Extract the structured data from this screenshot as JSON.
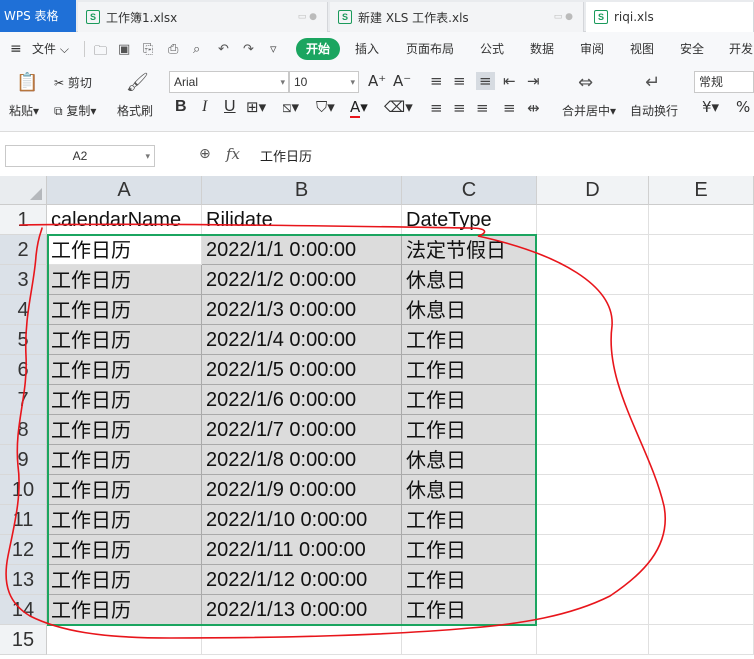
{
  "app": {
    "name": "WPS 表格"
  },
  "tabs": [
    {
      "label": "工作簿1.xlsx"
    },
    {
      "label": "新建 XLS 工作表.xls"
    },
    {
      "label": "riqi.xls"
    }
  ],
  "menu": {
    "file": "文件",
    "start": "开始",
    "insert": "插入",
    "page_layout": "页面布局",
    "formula": "公式",
    "data": "数据",
    "review": "审阅",
    "view": "视图",
    "security": "安全",
    "dev": "开发"
  },
  "ribbon": {
    "paste": "粘贴",
    "cut": "剪切",
    "copy": "复制",
    "format_painter": "格式刷",
    "font_name": "Arial",
    "font_size": "10",
    "bold": "B",
    "italic": "I",
    "underline": "U",
    "merge_center": "合并居中",
    "wrap_text": "自动换行",
    "number_format": "常规",
    "currency": "¥",
    "percent": "%"
  },
  "formula_bar": {
    "cell_ref": "A2",
    "fx": "fx",
    "value": "工作日历"
  },
  "columns": [
    "A",
    "B",
    "C",
    "D",
    "E"
  ],
  "rows": [
    {
      "num": "1",
      "a": "calendarName",
      "b": "Rilidate",
      "c": "DateType"
    },
    {
      "num": "2",
      "a": "工作日历",
      "b": "2022/1/1 0:00:00",
      "c": "法定节假日"
    },
    {
      "num": "3",
      "a": "工作日历",
      "b": "2022/1/2 0:00:00",
      "c": "休息日"
    },
    {
      "num": "4",
      "a": "工作日历",
      "b": "2022/1/3 0:00:00",
      "c": "休息日"
    },
    {
      "num": "5",
      "a": "工作日历",
      "b": "2022/1/4 0:00:00",
      "c": "工作日"
    },
    {
      "num": "6",
      "a": "工作日历",
      "b": "2022/1/5 0:00:00",
      "c": "工作日"
    },
    {
      "num": "7",
      "a": "工作日历",
      "b": "2022/1/6 0:00:00",
      "c": "工作日"
    },
    {
      "num": "8",
      "a": "工作日历",
      "b": "2022/1/7 0:00:00",
      "c": "工作日"
    },
    {
      "num": "9",
      "a": "工作日历",
      "b": "2022/1/8 0:00:00",
      "c": "休息日"
    },
    {
      "num": "10",
      "a": "工作日历",
      "b": "2022/1/9 0:00:00",
      "c": "休息日"
    },
    {
      "num": "11",
      "a": "工作日历",
      "b": "2022/1/10 0:00:00",
      "c": "工作日"
    },
    {
      "num": "12",
      "a": "工作日历",
      "b": "2022/1/11 0:00:00",
      "c": "工作日"
    },
    {
      "num": "13",
      "a": "工作日历",
      "b": "2022/1/12 0:00:00",
      "c": "工作日"
    },
    {
      "num": "14",
      "a": "工作日历",
      "b": "2022/1/13 0:00:00",
      "c": "工作日"
    },
    {
      "num": "15",
      "a": "",
      "b": "",
      "c": ""
    }
  ],
  "colors": {
    "accent_green": "#1ba560",
    "wps_blue": "#1f70d7",
    "annotation_red": "#e8151b",
    "selection_fill": "#dcdcdc"
  }
}
